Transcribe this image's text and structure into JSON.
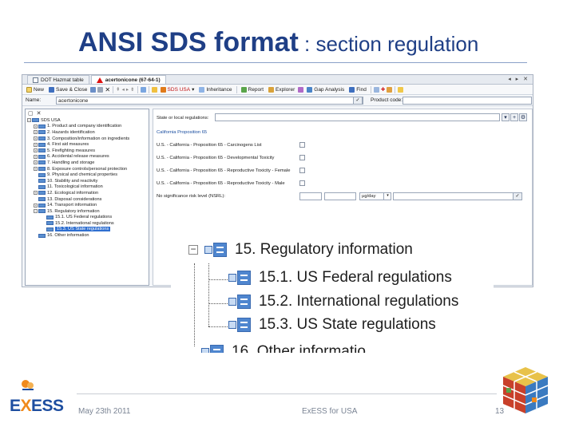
{
  "slide": {
    "title_bold": "ANSI SDS format",
    "title_rest": " : section regulation",
    "footer_date": "May 23th 2011",
    "footer_center": "ExESS for USA",
    "page_number": "13",
    "logo_text_1": "E",
    "logo_text_x": "X",
    "logo_text_2": "ESS"
  },
  "app": {
    "tabs": [
      {
        "label": "DOT Hazmat table"
      },
      {
        "label": "acertonicone (67-64-1)"
      }
    ],
    "window_controls": "◂ ▸ ✕",
    "toolbar": {
      "new": "New",
      "save_close": "Save & Close",
      "sds_usa": "SDS USA",
      "inheritance": "Inheritance",
      "report": "Report",
      "explorer": "Explorer",
      "gap_analysis": "Gap Analysis",
      "find": "Find"
    },
    "name_label": "Name:",
    "name_value": "acertonicone",
    "product_code_label": "Product code:",
    "tree_root": "SDS USA",
    "tree_items": [
      {
        "label": "1. Product and company identification",
        "expandable": true
      },
      {
        "label": "2. Hazards identification",
        "expandable": true
      },
      {
        "label": "3. Composition/information on ingredients",
        "expandable": true
      },
      {
        "label": "4. First aid measures",
        "expandable": true
      },
      {
        "label": "5. Firefighting measures",
        "expandable": true
      },
      {
        "label": "6. Accidental release measures",
        "expandable": true
      },
      {
        "label": "7. Handling and storage",
        "expandable": true
      },
      {
        "label": "8. Exposure controls/personal protection",
        "expandable": true
      },
      {
        "label": "9. Physical and chemical properties",
        "expandable": false
      },
      {
        "label": "10. Stability and reactivity",
        "expandable": false
      },
      {
        "label": "11. Toxicological information",
        "expandable": false
      },
      {
        "label": "12. Ecological information",
        "expandable": true
      },
      {
        "label": "13. Disposal considerations",
        "expandable": false
      },
      {
        "label": "14. Transport information",
        "expandable": true
      },
      {
        "label": "15. Regulatory information",
        "expandable": true,
        "expanded": true
      },
      {
        "label": "15.1. US Federal regulations",
        "child": true
      },
      {
        "label": "15.2. International regulations",
        "child": true
      },
      {
        "label": "15.3. US State regulations",
        "child": true,
        "selected": true
      },
      {
        "label": "16. Other information",
        "expandable": false
      }
    ],
    "state_label": "State or local regulations:",
    "prop65_heading": "California Proposition 65",
    "prop65_rows": [
      "U.S. - California - Proposition 65 - Carcinogens List",
      "U.S. - California - Proposition 65 - Developmental Toxicity",
      "U.S. - California - Proposition 65 - Reproductive Toxicity - Female",
      "U.S. - California - Proposition 65 - Reproductive Toxicity - Male"
    ],
    "nsrl_label": "No significance risk level (NSRL):",
    "nsrl_unit": "µg/day"
  },
  "zoom": {
    "parent": "15. Regulatory information",
    "children": [
      "15.1. US Federal regulations",
      "15.2. International regulations",
      "15.3. US State regulations"
    ],
    "next_partial": "16. Other informatio"
  }
}
